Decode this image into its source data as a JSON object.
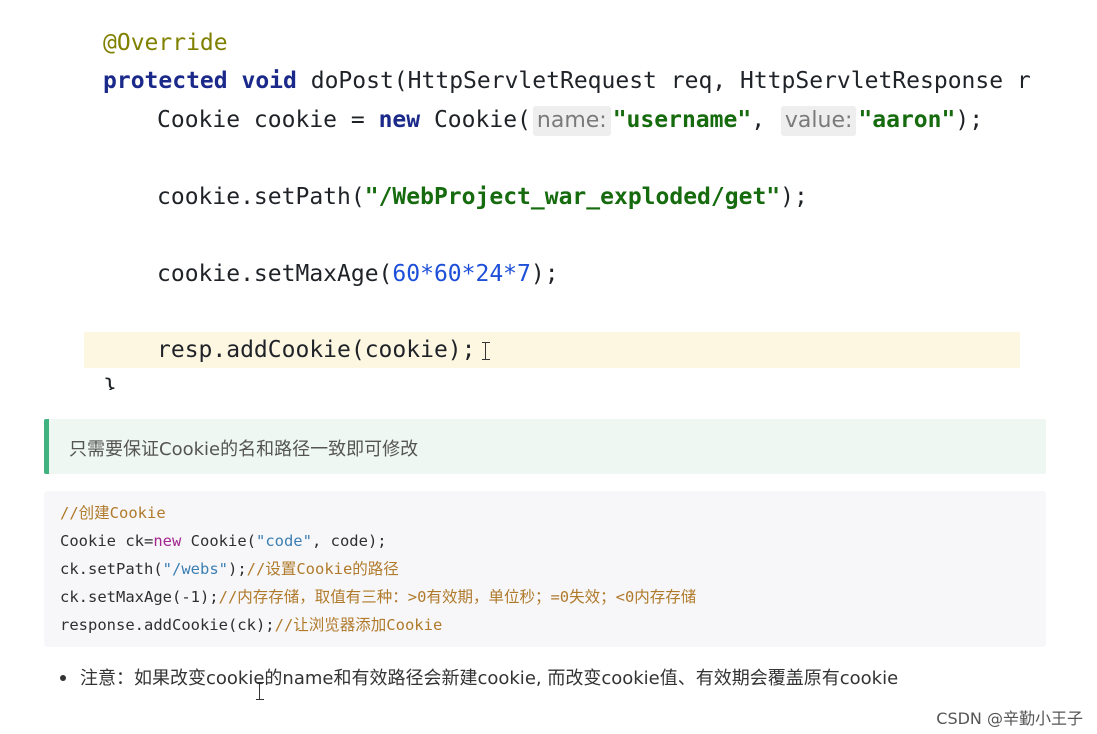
{
  "ide": {
    "annotation": "@Override",
    "method_kw_protected": "protected",
    "method_kw_void": "void",
    "method_sig": " doPost(HttpServletRequest req, HttpServletResponse r",
    "line3_prefix": "Cookie cookie = ",
    "line3_new": "new",
    "line3_ctor": " Cookie(",
    "hint_name": "name:",
    "arg_name": "\"username\"",
    "comma": ",",
    "hint_value": "value:",
    "arg_value": "\"aaron\"",
    "line3_end": ");",
    "line4_prefix": "cookie.setPath(",
    "line4_str": "\"/WebProject_war_exploded/get\"",
    "line4_end": ");",
    "line5_prefix": "cookie.setMaxAge(",
    "line5_num": "60*60*24*7",
    "line5_end": ");",
    "line6": "resp.addCookie(cookie);",
    "closing_brace": "}"
  },
  "quote": {
    "text": "只需要保证Cookie的名和路径一致即可修改"
  },
  "codeblock": {
    "l1_comment": "//创建Cookie",
    "l2_a": "Cookie ck=",
    "l2_kw": "new",
    "l2_b": " Cookie(",
    "l2_str": "\"code\"",
    "l2_c": ", code);",
    "l3_a": "ck.setPath(",
    "l3_str": "\"/webs\"",
    "l3_b": ");",
    "l3_comment": "//设置Cookie的路径",
    "l4_a": "ck.setMaxAge(-1);",
    "l4_comment": "//内存存储，取值有三种：>0有效期，单位秒；=0失效；<0内存存储",
    "l5_a": "response.addCookie(ck);",
    "l5_comment": "//让浏览器添加Cookie"
  },
  "bullet": {
    "text": "注意：如果改变cookie的name和有效路径会新建cookie, 而改变cookie值、有效期会覆盖原有cookie"
  },
  "watermark": "CSDN @辛勤小王子"
}
